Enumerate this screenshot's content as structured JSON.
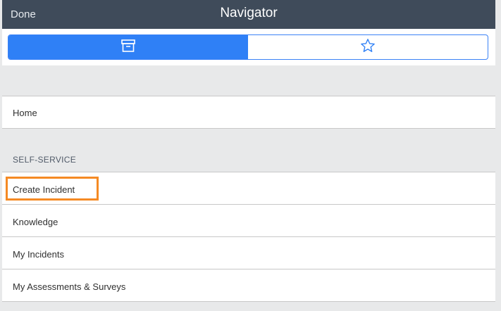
{
  "header": {
    "done_label": "Done",
    "title": "Navigator"
  },
  "toolbar": {
    "tabs": [
      {
        "icon": "archive-box-icon",
        "active": true
      },
      {
        "icon": "star-icon",
        "active": false
      }
    ]
  },
  "navigator": {
    "home_label": "Home",
    "section_title": "SELF-SERVICE",
    "items": [
      {
        "label": "Create Incident"
      },
      {
        "label": "Knowledge"
      },
      {
        "label": "My Incidents"
      },
      {
        "label": "My Assessments & Surveys"
      }
    ]
  },
  "colors": {
    "header_bg": "#3f4b5a",
    "accent": "#2f80f6",
    "highlight": "#f58a24",
    "page_bg": "#e8e9ea"
  }
}
